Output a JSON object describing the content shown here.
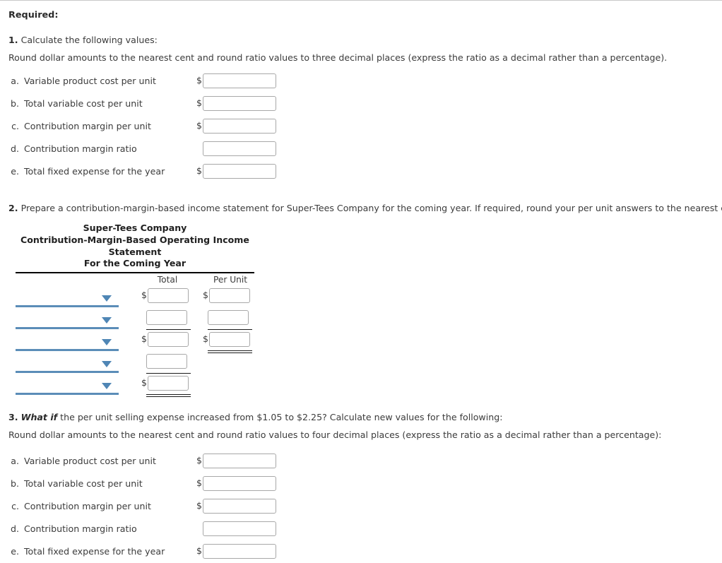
{
  "header": {
    "required_label": "Required:"
  },
  "q1": {
    "number": "1.",
    "prompt": " Calculate the following values:",
    "rounding": "Round dollar amounts to the nearest cent and round ratio values to three decimal places (express the ratio as a decimal rather than a percentage).",
    "items": [
      {
        "letter": "a.",
        "label": "Variable product cost per unit",
        "prefix": "$",
        "value": ""
      },
      {
        "letter": "b.",
        "label": "Total variable cost per unit",
        "prefix": "$",
        "value": ""
      },
      {
        "letter": "c.",
        "label": "Contribution margin per unit",
        "prefix": "$",
        "value": ""
      },
      {
        "letter": "d.",
        "label": "Contribution margin ratio",
        "prefix": "",
        "value": ""
      },
      {
        "letter": "e.",
        "label": "Total fixed expense for the year",
        "prefix": "$",
        "value": ""
      }
    ]
  },
  "q2": {
    "number": "2.",
    "prompt": " Prepare a contribution-margin-based income statement for Super-Tees Company for the coming year. If required, round your per unit answers to the nearest cent.",
    "statement": {
      "company": "Super-Tees Company",
      "title": "Contribution-Margin-Based Operating Income Statement",
      "period": "For the Coming Year",
      "columns": [
        "Total",
        "Per Unit"
      ],
      "rows": [
        {
          "select_value": "",
          "total_prefix": "$",
          "total_value": "",
          "perunit_prefix": "$",
          "perunit_value": ""
        },
        {
          "select_value": "",
          "total_prefix": "",
          "total_value": "",
          "perunit_prefix": "",
          "perunit_value": ""
        },
        {
          "select_value": "",
          "total_prefix": "$",
          "total_value": "",
          "perunit_prefix": "$",
          "perunit_value": ""
        },
        {
          "select_value": "",
          "total_prefix": "",
          "total_value": "",
          "perunit_prefix": null,
          "perunit_value": null
        },
        {
          "select_value": "",
          "total_prefix": "$",
          "total_value": "",
          "perunit_prefix": null,
          "perunit_value": null
        }
      ]
    }
  },
  "q3": {
    "number": "3.",
    "emphasis": "What if",
    "prompt": " the per unit selling expense increased from $1.05 to $2.25? Calculate new values for the following:",
    "rounding": "Round dollar amounts to the nearest cent and round ratio values to four decimal places (express the ratio as a decimal rather than a percentage):",
    "items": [
      {
        "letter": "a.",
        "label": "Variable product cost per unit",
        "prefix": "$",
        "value": ""
      },
      {
        "letter": "b.",
        "label": "Total variable cost per unit",
        "prefix": "$",
        "value": ""
      },
      {
        "letter": "c.",
        "label": "Contribution margin per unit",
        "prefix": "$",
        "value": ""
      },
      {
        "letter": "d.",
        "label": "Contribution margin ratio",
        "prefix": "",
        "value": ""
      },
      {
        "letter": "e.",
        "label": "Total fixed expense for the year",
        "prefix": "$",
        "value": ""
      }
    ]
  },
  "colors": {
    "select_underline": "#5b8db8",
    "caret": "#4f86b5",
    "rule": "#000000",
    "input_border": "#a8a8a8"
  }
}
